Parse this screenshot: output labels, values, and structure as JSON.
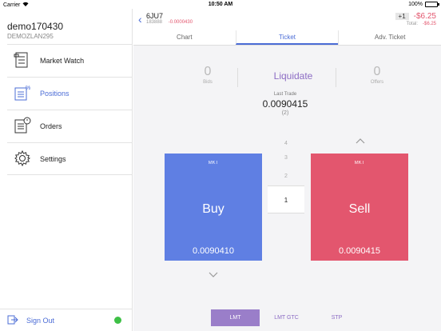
{
  "status_bar": {
    "carrier": "Carrier",
    "time": "10:50 AM",
    "battery": "100%"
  },
  "colors": {
    "accent": "#4b6cd6",
    "buy": "#5f7fe3",
    "sell": "#e3566e",
    "liquidate": "#8c6cc4",
    "online": "#3ec046"
  },
  "sidebar": {
    "account_name": "demo170430",
    "account_id": "DEMOZLAN295",
    "items": [
      {
        "label": "Market Watch",
        "icon": "market-watch-icon"
      },
      {
        "label": "Positions",
        "icon": "positions-icon"
      },
      {
        "label": "Orders",
        "icon": "orders-icon"
      },
      {
        "label": "Settings",
        "icon": "gear-icon"
      }
    ],
    "sign_out": "Sign Out"
  },
  "header": {
    "symbol": "6JU7",
    "code": "183888",
    "change": "-0.0000430",
    "position_qty": "+1",
    "open_pl": "-$6.25",
    "total_label": "Total:",
    "total_value": "-$6.25"
  },
  "tabs": [
    {
      "label": "Chart"
    },
    {
      "label": "Ticket"
    },
    {
      "label": "Adv. Ticket"
    }
  ],
  "ticket": {
    "bids_count": "0",
    "bids_label": "Bids",
    "liquidate_label": "Liquidate",
    "offers_count": "0",
    "offers_label": "Offers",
    "last_trade_label": "Last Trade",
    "last_trade_price": "0.0090415",
    "last_trade_size": "(2)",
    "quantities": [
      "4",
      "3",
      "2",
      "1"
    ],
    "buy": {
      "type": "MKT",
      "label": "Buy",
      "price": "0.0090410"
    },
    "sell": {
      "type": "MKT",
      "label": "Sell",
      "price": "0.0090415"
    }
  },
  "order_types": [
    {
      "label": "LMT"
    },
    {
      "label": "LMT GTC"
    },
    {
      "label": "STP"
    }
  ]
}
